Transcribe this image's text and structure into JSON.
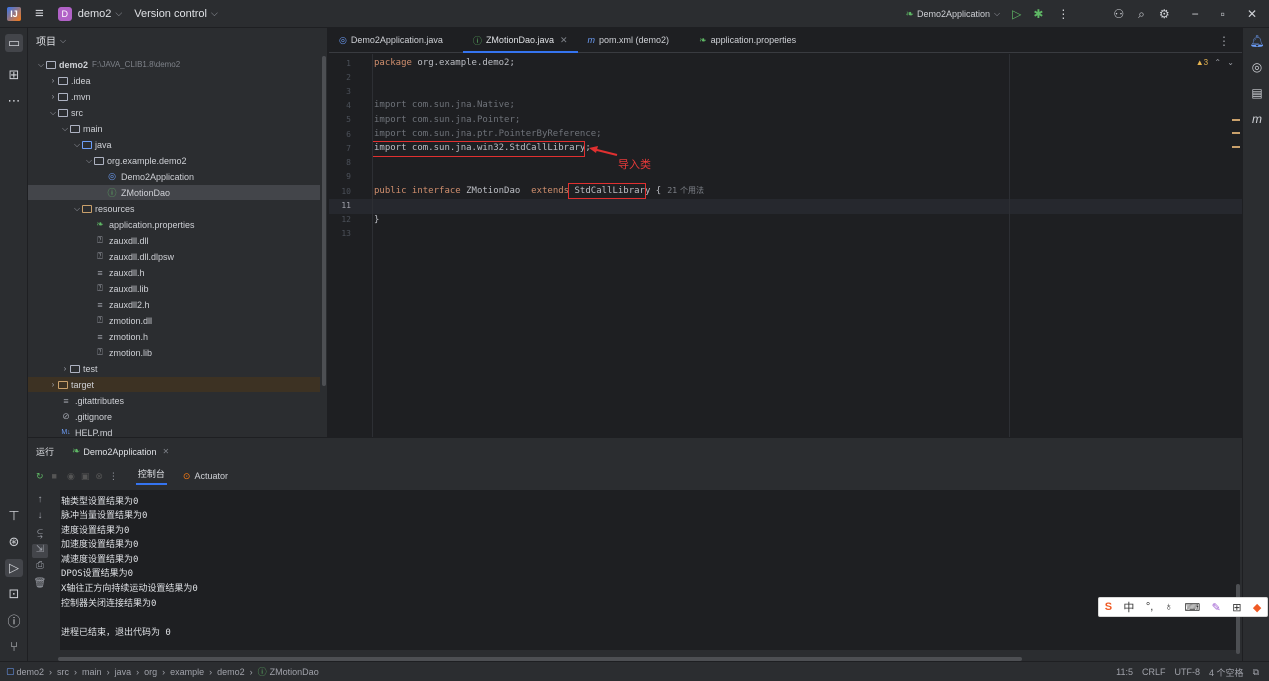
{
  "titlebar": {
    "project_badge": "D",
    "project_name": "demo2",
    "vcs": "Version control",
    "run_config": "Demo2Application"
  },
  "project_panel": {
    "title": "项目",
    "tree": [
      {
        "label": "demo2",
        "hint": "F:\\JAVA_CLIB1.8\\demo2"
      },
      {
        "label": ".idea"
      },
      {
        "label": ".mvn"
      },
      {
        "label": "src"
      },
      {
        "label": "main"
      },
      {
        "label": "java"
      },
      {
        "label": "org.example.demo2"
      },
      {
        "label": "Demo2Application"
      },
      {
        "label": "ZMotionDao"
      },
      {
        "label": "resources"
      },
      {
        "label": "application.properties"
      },
      {
        "label": "zauxdll.dll"
      },
      {
        "label": "zauxdll.dll.dlpsw"
      },
      {
        "label": "zauxdll.h"
      },
      {
        "label": "zauxdll.lib"
      },
      {
        "label": "zauxdll2.h"
      },
      {
        "label": "zmotion.dll"
      },
      {
        "label": "zmotion.h"
      },
      {
        "label": "zmotion.lib"
      },
      {
        "label": "test"
      },
      {
        "label": "target"
      },
      {
        "label": ".gitattributes"
      },
      {
        "label": ".gitignore"
      },
      {
        "label": "HELP.md"
      }
    ]
  },
  "editor": {
    "tabs": [
      {
        "label": "Demo2Application.java"
      },
      {
        "label": "ZMotionDao.java"
      },
      {
        "label": "pom.xml (demo2)"
      },
      {
        "label": "application.properties"
      }
    ],
    "line_numbers": [
      "1",
      "2",
      "3",
      "4",
      "5",
      "6",
      "7",
      "8",
      "9",
      "10",
      "11",
      "12",
      "13"
    ],
    "code": {
      "l1_kw": "package",
      "l1_rest": " org.example.demo2;",
      "l4": "import com.sun.jna.Native;",
      "l5": "import com.sun.jna.Pointer;",
      "l6": "import com.sun.jna.ptr.PointerByReference;",
      "l7": "import com.sun.jna.win32.StdCallLibrary;",
      "l10_kw1": "public interface",
      "l10_name": " ZMotionDao ",
      "l10_kw2": " extends ",
      "l10_super": "StdCallLibrary",
      "l10_brace": " {",
      "l10_usages": "21 个用法",
      "l12": "}"
    },
    "annotation": "导入类",
    "warnings": "▲3"
  },
  "run_panel": {
    "label": "运行",
    "config_tab": "Demo2Application",
    "tab_console": "控制台",
    "tab_actuator": "Actuator",
    "console_lines": [
      "轴类型设置结果为0",
      "脉冲当量设置结果为0",
      "速度设置结果为0",
      "加速度设置结果为0",
      "减速度设置结果为0",
      "DPOS设置结果为0",
      "X轴往正方向持续运动设置结果为0",
      "控制器关闭连接结果为0",
      "",
      "进程已结束，退出代码为 0"
    ]
  },
  "statusbar": {
    "breadcrumb": [
      "demo2",
      "src",
      "main",
      "java",
      "org",
      "example",
      "demo2",
      "ZMotionDao"
    ],
    "position": "11:5",
    "line_sep": "CRLF",
    "encoding": "UTF-8",
    "indent": "4 个空格"
  },
  "ime": {
    "lang": "中"
  }
}
